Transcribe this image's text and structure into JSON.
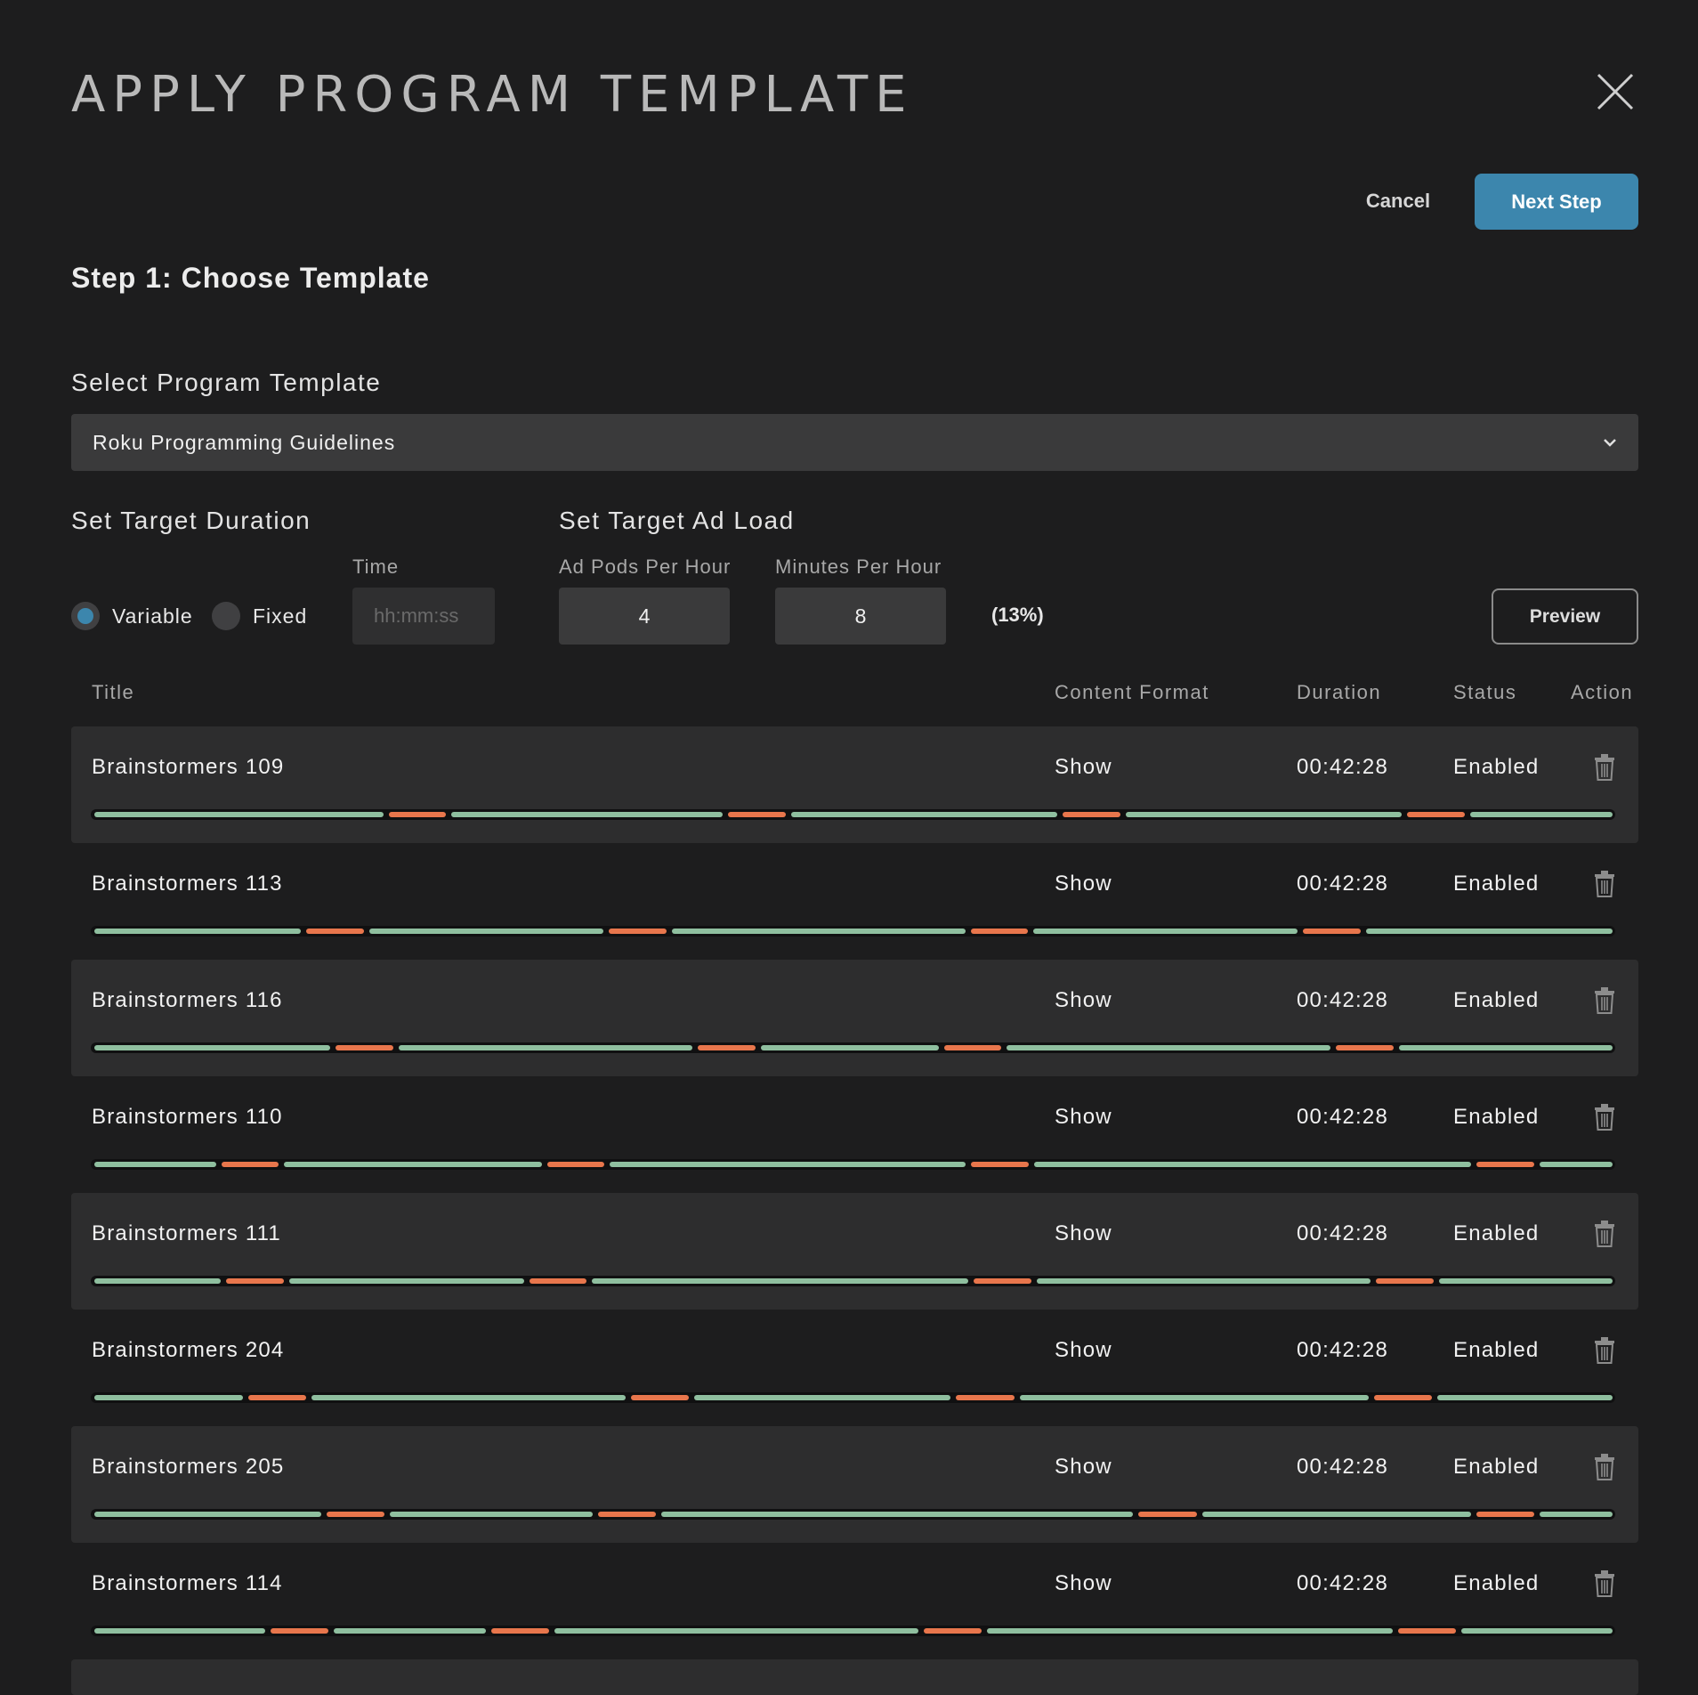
{
  "dialog": {
    "title": "APPLY PROGRAM TEMPLATE",
    "cancel_label": "Cancel",
    "next_label": "Next Step",
    "step_title": "Step 1: Choose Template"
  },
  "template": {
    "label": "Select Program Template",
    "selected": "Roku Programming Guidelines"
  },
  "duration": {
    "label": "Set Target Duration",
    "time_label": "Time",
    "time_placeholder": "hh:mm:ss",
    "time_value": "",
    "options": [
      "Variable",
      "Fixed"
    ],
    "selected": "Variable"
  },
  "adload": {
    "label": "Set Target Ad Load",
    "pods_label": "Ad Pods Per Hour",
    "pods_value": "4",
    "minutes_label": "Minutes Per Hour",
    "minutes_value": "8",
    "percent": "(13%)",
    "preview_label": "Preview"
  },
  "table": {
    "headers": [
      "Title",
      "Content Format",
      "Duration",
      "Status",
      "Action"
    ],
    "rows": [
      {
        "title": "Brainstormers 109",
        "format": "Show",
        "duration": "00:42:28",
        "status": "Enabled"
      },
      {
        "title": "Brainstormers 113",
        "format": "Show",
        "duration": "00:42:28",
        "status": "Enabled"
      },
      {
        "title": "Brainstormers 116",
        "format": "Show",
        "duration": "00:42:28",
        "status": "Enabled"
      },
      {
        "title": "Brainstormers 110",
        "format": "Show",
        "duration": "00:42:28",
        "status": "Enabled"
      },
      {
        "title": "Brainstormers 111",
        "format": "Show",
        "duration": "00:42:28",
        "status": "Enabled"
      },
      {
        "title": "Brainstormers 204",
        "format": "Show",
        "duration": "00:42:28",
        "status": "Enabled"
      },
      {
        "title": "Brainstormers 205",
        "format": "Show",
        "duration": "00:42:28",
        "status": "Enabled"
      },
      {
        "title": "Brainstormers 114",
        "format": "Show",
        "duration": "00:42:28",
        "status": "Enabled"
      }
    ],
    "segment_colors": {
      "content": "#8fbf9f",
      "ad": "#e8764c"
    }
  }
}
